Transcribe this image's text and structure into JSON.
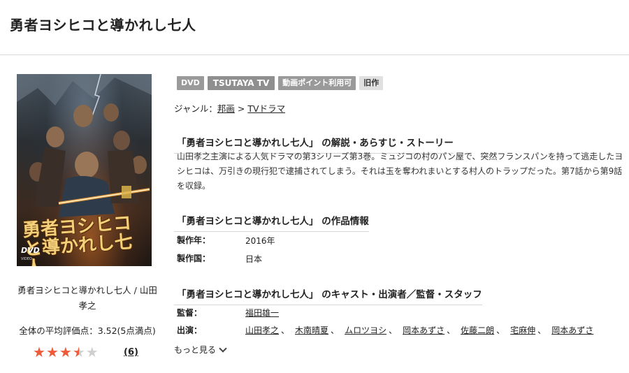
{
  "page": {
    "title": "勇者ヨシヒコと導かれし七人"
  },
  "poster": {
    "title_text": "勇者ヨシヒコと導かれし七人",
    "dvd_label": "DVD",
    "dvd_sub": "VIDEO"
  },
  "sidebar": {
    "title": "勇者ヨシヒコと導かれし七人 / 山田孝之",
    "rating_text": "全体の平均評価点：3.52(5点満点)",
    "rating_value": 3.52,
    "rating_max": 5,
    "review_count": "(6)",
    "colors": {
      "star_on": "#ef5a3a",
      "star_off": "#cfcfcf"
    }
  },
  "badges": [
    "DVD",
    "TSUTAYA TV",
    "動画ポイント利用可",
    "旧作"
  ],
  "genre": {
    "label": "ジャンル：",
    "items": [
      "邦画",
      "TVドラマ"
    ],
    "separator": ">"
  },
  "synopsis": {
    "heading": "「勇者ヨシヒコと導かれし七人」 の解説・あらすじ・ストーリー",
    "text": "山田孝之主演による人気ドラマの第3シリーズ第3巻。ミュジコの村のパン屋で、突然フランスパンを持って逃走したヨシヒコは、万引きの現行犯で逮捕されてしまう。それは玉を奪われまいとする村人のトラップだった。第7話から第9話を収録。"
  },
  "work_info": {
    "heading": "「勇者ヨシヒコと導かれし七人」 の作品情報",
    "rows": [
      {
        "label": "製作年：",
        "value": "2016年"
      },
      {
        "label": "製作国：",
        "value": "日本"
      }
    ]
  },
  "staff": {
    "heading": "「勇者ヨシヒコと導かれし七人」 のキャスト・出演者／監督・スタッフ",
    "director_label": "監督：",
    "director": "福田雄一",
    "cast_label": "出演：",
    "cast": [
      "山田孝之",
      "木南晴夏",
      "ムロツヨシ",
      "岡本あずさ",
      "佐藤二朗",
      "宅麻伸",
      "岡本あずさ"
    ],
    "cast_separator": "、",
    "more_label": "もっと見る"
  }
}
